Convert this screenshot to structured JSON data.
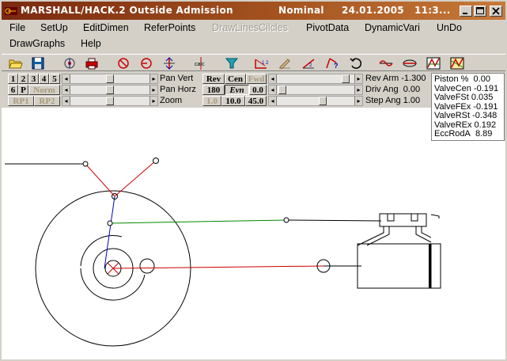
{
  "window": {
    "title": "MARSHALL/HACK.2 Outside Admission",
    "mode": "Nominal",
    "date": "24.01.2005",
    "time": "11:3..."
  },
  "menu": [
    {
      "label": "File",
      "enabled": true
    },
    {
      "label": "SetUp",
      "enabled": true
    },
    {
      "label": "EditDimen",
      "enabled": true
    },
    {
      "label": "ReferPoints",
      "enabled": true
    },
    {
      "label": "DrawLinesCilcles",
      "enabled": false
    },
    {
      "label": "PivotData",
      "enabled": true
    },
    {
      "label": "DynamicVari",
      "enabled": true
    },
    {
      "label": "UnDo",
      "enabled": true
    },
    {
      "label": "DrawGraphs",
      "enabled": true
    },
    {
      "label": "Help",
      "enabled": true
    }
  ],
  "toolbar": {
    "icons": [
      "open-folder-icon",
      "save-icon",
      "target-icon",
      "print-icon",
      "no-entry-icon",
      "arrow-circle-icon",
      "move-vertical-icon",
      "calculator-icon",
      "funnel-icon",
      "measure-icon",
      "pen-icon",
      "angle-icon",
      "question-icon",
      "undo-icon",
      "wave-icon",
      "link-icon",
      "graph-icon",
      "graph2-icon"
    ],
    "calc_label": "calc"
  },
  "left_panel": {
    "num_buttons_row1": [
      "1",
      "2",
      "3",
      "4",
      "5"
    ],
    "row2_btn_6": "6",
    "row2_btn_p": "P",
    "row2_btn_norm": "Norm",
    "row3_btn_rp1": "RP1",
    "row3_btn_rp2": "RP2",
    "sliders": [
      {
        "label": "Pan Vert",
        "position": 0.5
      },
      {
        "label": "Pan Horz",
        "position": 0.5
      },
      {
        "label": "Zoom",
        "position": 0.5
      }
    ]
  },
  "right_panel": {
    "btn_rev": "Rev",
    "btn_cen": "Cen",
    "btn_fwd": "Fwd",
    "btn_180": "180",
    "btn_evn": "Evn",
    "btn_00": "0.0",
    "btn_10": "1.0",
    "btn_100": "10.0",
    "btn_450": "45.0",
    "sliders": [
      {
        "label": "Rev Arm",
        "value": "-1.300",
        "position": 0.93
      },
      {
        "label": "Driv Ang",
        "value": "0.00",
        "position": 0.02
      },
      {
        "label": "Step Ang",
        "value": "1.00",
        "position": 0.6
      }
    ]
  },
  "readout": [
    {
      "key": "Piston %",
      "value": "0.00"
    },
    {
      "key": "ValveCen",
      "value": "-0.191"
    },
    {
      "key": "ValveFSt",
      "value": "0.035"
    },
    {
      "key": "ValveFEx",
      "value": "-0.191"
    },
    {
      "key": "ValveRSt",
      "value": "-0.348"
    },
    {
      "key": "ValveREx",
      "value": "0.192"
    },
    {
      "key": "EccRodA",
      "value": "8.89"
    }
  ],
  "colors": {
    "red_link": "#cc0000",
    "blue_link": "#0000cc",
    "green_link": "#008800",
    "black": "#000000"
  }
}
